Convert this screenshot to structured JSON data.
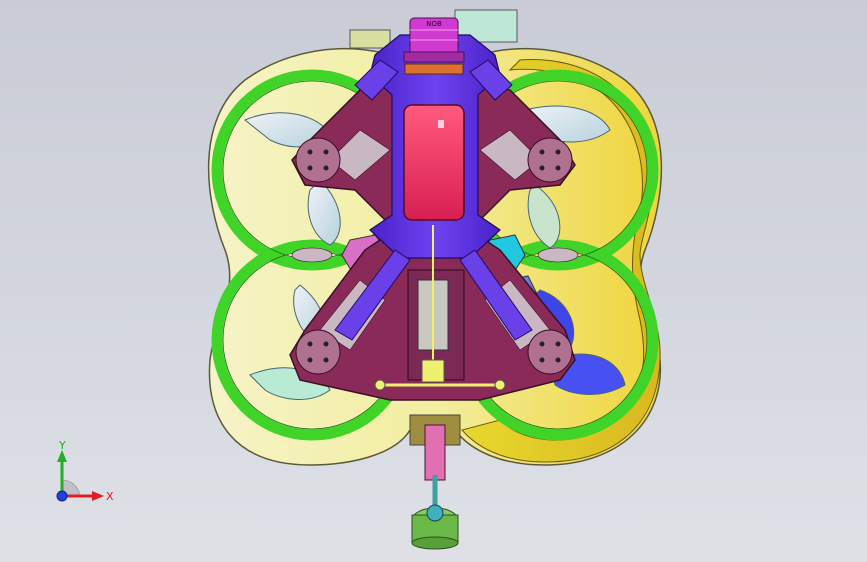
{
  "scene": {
    "title": "",
    "colors": {
      "background": "#d0d3db",
      "frame": "#8c2c5a",
      "center_plate": "#5a2fd6",
      "battery": "#e8285f",
      "duct_green": "#43d62a",
      "duct_yellow": "#e8d82e",
      "duct_cream": "#f0efb8",
      "camera": "#d03ad0"
    }
  },
  "labels": {
    "camera_text": "NOB"
  },
  "triad": {
    "x_label": "X",
    "y_label": "Y",
    "x_color": "#e02020",
    "y_color": "#20b020",
    "z_color": "#2040e0"
  }
}
